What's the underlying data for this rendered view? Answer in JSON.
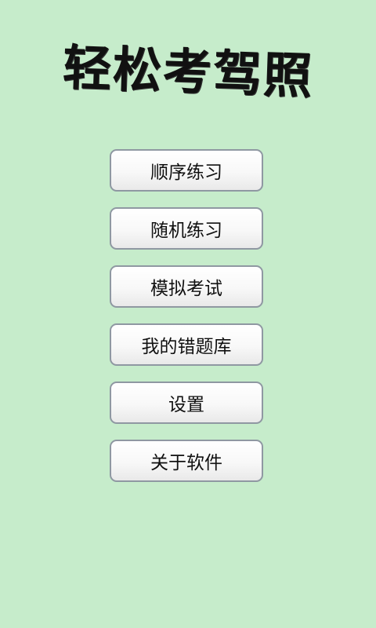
{
  "colors": {
    "background": "#c6eccb",
    "button_bg": "#f7f7f7",
    "button_border": "#8f98a2",
    "text": "#111111"
  },
  "header": {
    "title": "轻松考驾照"
  },
  "menu": {
    "buttons": [
      {
        "label": "顺序练习"
      },
      {
        "label": "随机练习"
      },
      {
        "label": "模拟考试"
      },
      {
        "label": "我的错题库"
      },
      {
        "label": "设置"
      },
      {
        "label": "关于软件"
      }
    ]
  }
}
